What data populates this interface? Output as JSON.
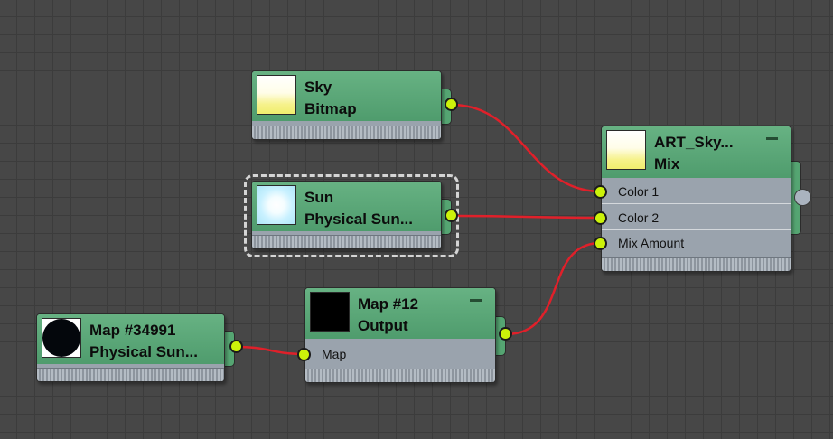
{
  "nodes": {
    "sky": {
      "name": "Sky",
      "type": "Bitmap"
    },
    "sun": {
      "name": "Sun",
      "type": "Physical Sun..."
    },
    "art_sky": {
      "name": "ART_Sky...",
      "type": "Mix",
      "inputs": [
        "Color 1",
        "Color 2",
        "Mix Amount"
      ]
    },
    "map12": {
      "name": "Map #12",
      "type": "Output",
      "inputs": [
        "Map"
      ]
    },
    "map34991": {
      "name": "Map #34991",
      "type": "Physical Sun..."
    }
  },
  "colors": {
    "canvas": "#474747",
    "node_header": "#5aa877",
    "node_body": "#9aa3ad",
    "port": "#ccf20a",
    "wire": "#e0202a"
  },
  "icons": {
    "collapse": "minus-icon",
    "selection": "dashed-outline"
  }
}
